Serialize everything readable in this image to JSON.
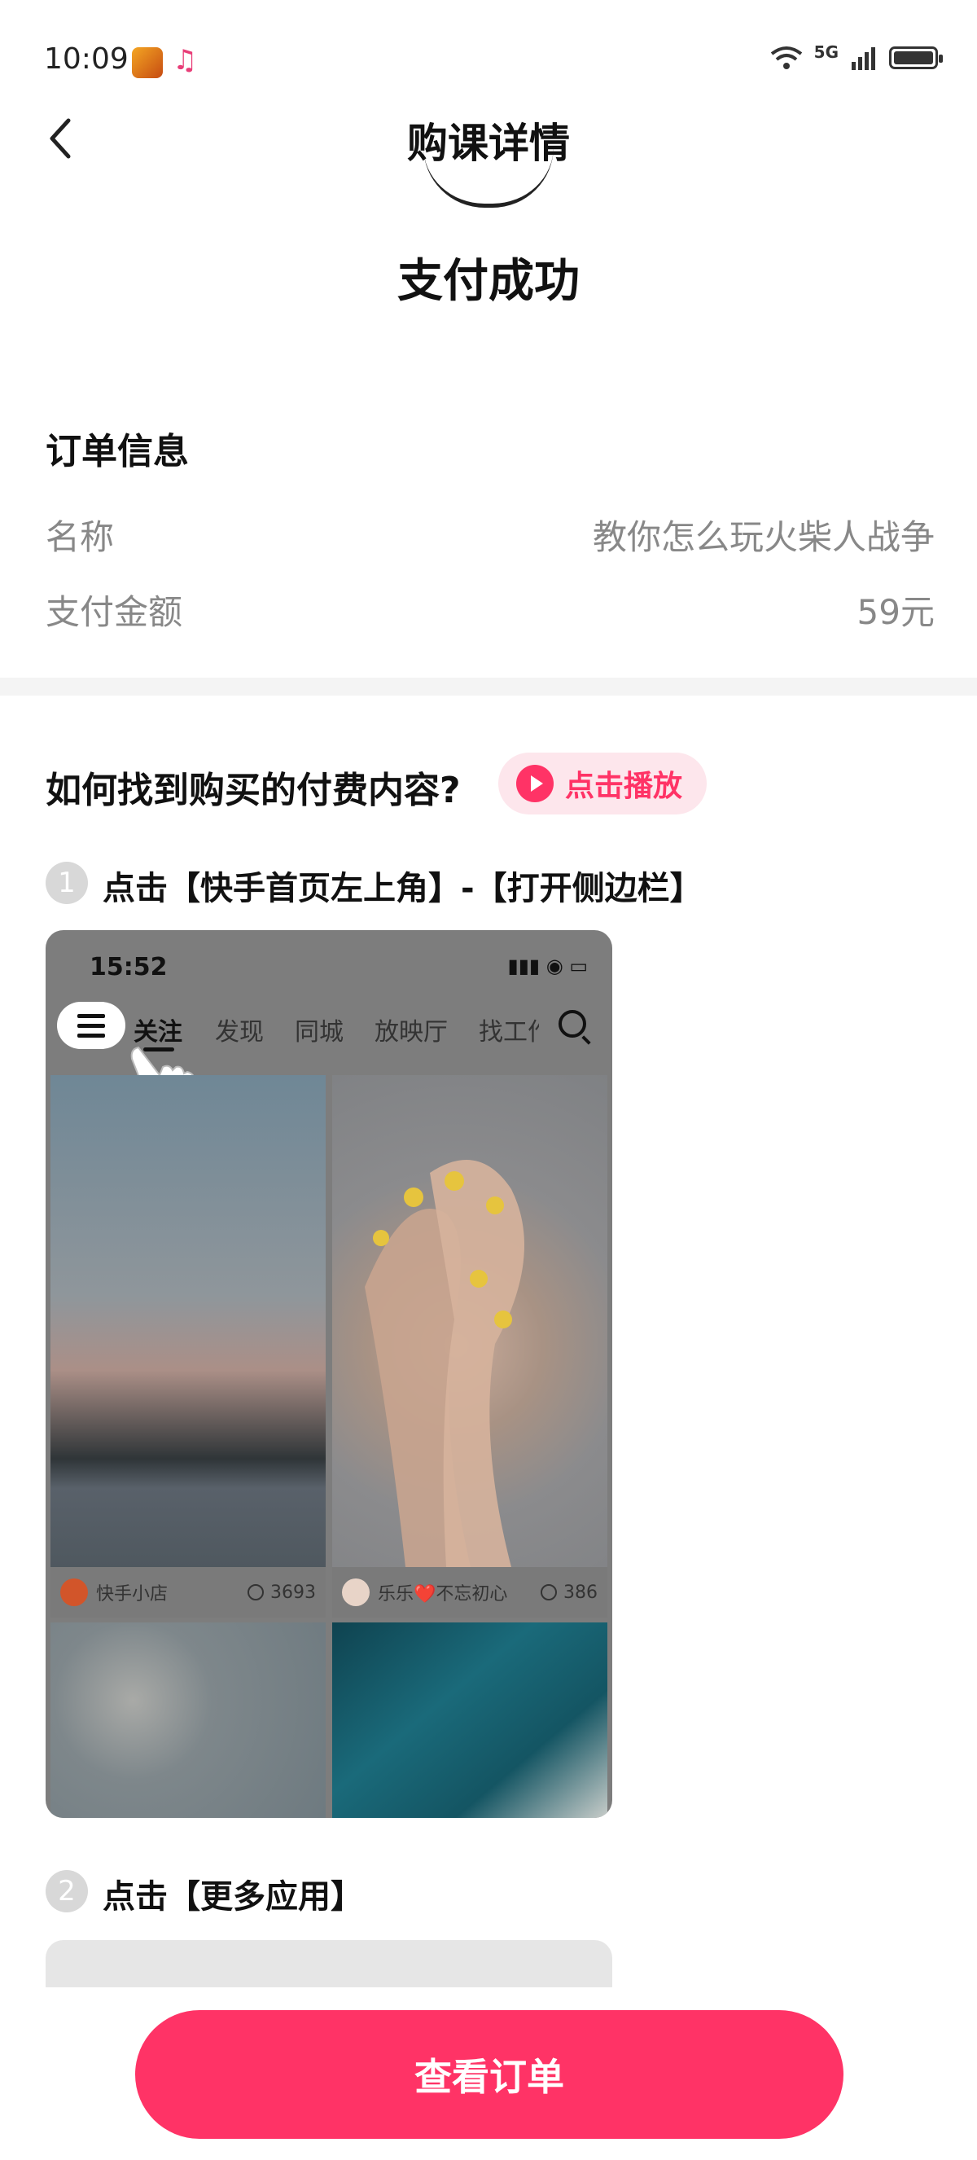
{
  "status_bar": {
    "time": "10:09",
    "network": "5G",
    "icons": [
      "wifi-icon",
      "signal-icon",
      "battery-icon"
    ]
  },
  "header": {
    "title": "购课详情",
    "back_icon": "chevron-left-icon"
  },
  "payment": {
    "status": "支付成功"
  },
  "order_info": {
    "title": "订单信息",
    "rows": [
      {
        "label": "名称",
        "value": "教你怎么玩火柴人战争"
      },
      {
        "label": "支付金额",
        "value": "59元"
      }
    ]
  },
  "howto": {
    "title": "如何找到购买的付费内容?",
    "play_label": "点击播放",
    "steps": [
      {
        "num": "1",
        "text": "点击【快手首页左上角】-【打开侧边栏】"
      },
      {
        "num": "2",
        "text": "点击【更多应用】"
      }
    ]
  },
  "mock1": {
    "time": "15:52",
    "tabs": [
      "关注",
      "发现",
      "同城",
      "放映厅",
      "找工作"
    ],
    "cards": [
      {
        "author": "快手小店",
        "count": "3693"
      },
      {
        "author": "乐乐❤️不忘初心",
        "count": "386"
      }
    ]
  },
  "footer": {
    "button_label": "查看订单"
  },
  "colors": {
    "accent": "#ff3366",
    "pill_bg": "#fde6ec"
  }
}
